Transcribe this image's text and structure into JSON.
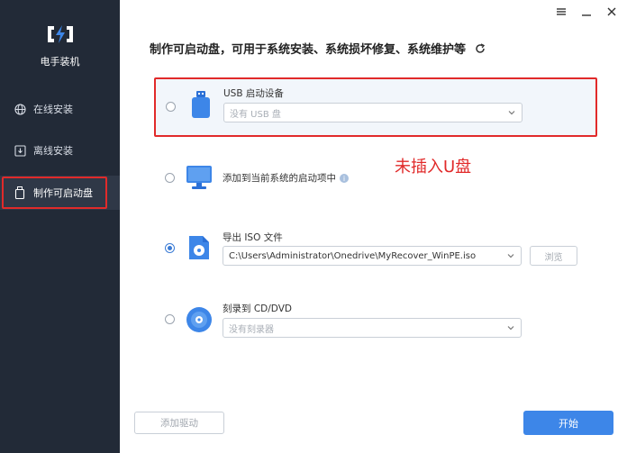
{
  "app": {
    "name": "电手装机"
  },
  "window_controls": [
    "menu-icon",
    "minimize-icon",
    "close-icon"
  ],
  "sidebar": {
    "items": [
      {
        "label": "在线安装",
        "icon": "globe-icon"
      },
      {
        "label": "离线安装",
        "icon": "download-icon"
      },
      {
        "label": "制作可启动盘",
        "icon": "usb-drive-icon",
        "active": true
      }
    ]
  },
  "main": {
    "title": "制作可启动盘，可用于系统安装、系统损坏修复、系统维护等",
    "options": [
      {
        "label": "USB 启动设备",
        "select_value": "没有 USB 盘",
        "checked": false
      },
      {
        "label": "添加到当前系统的启动项中",
        "checked": false
      },
      {
        "label": "导出 ISO 文件",
        "select_value": "C:\\Users\\Administrator\\Onedrive\\MyRecover_WinPE.iso",
        "browse_label": "浏览",
        "checked": true
      },
      {
        "label": "刻录到 CD/DVD",
        "select_value": "没有刻录器",
        "checked": false
      }
    ],
    "annotation": "未插入U盘"
  },
  "footer": {
    "add_driver_label": "添加驱动",
    "start_label": "开始"
  },
  "colors": {
    "sidebar_bg": "#222a37",
    "accent": "#3d86e8",
    "highlight_red": "#e12a2a"
  }
}
